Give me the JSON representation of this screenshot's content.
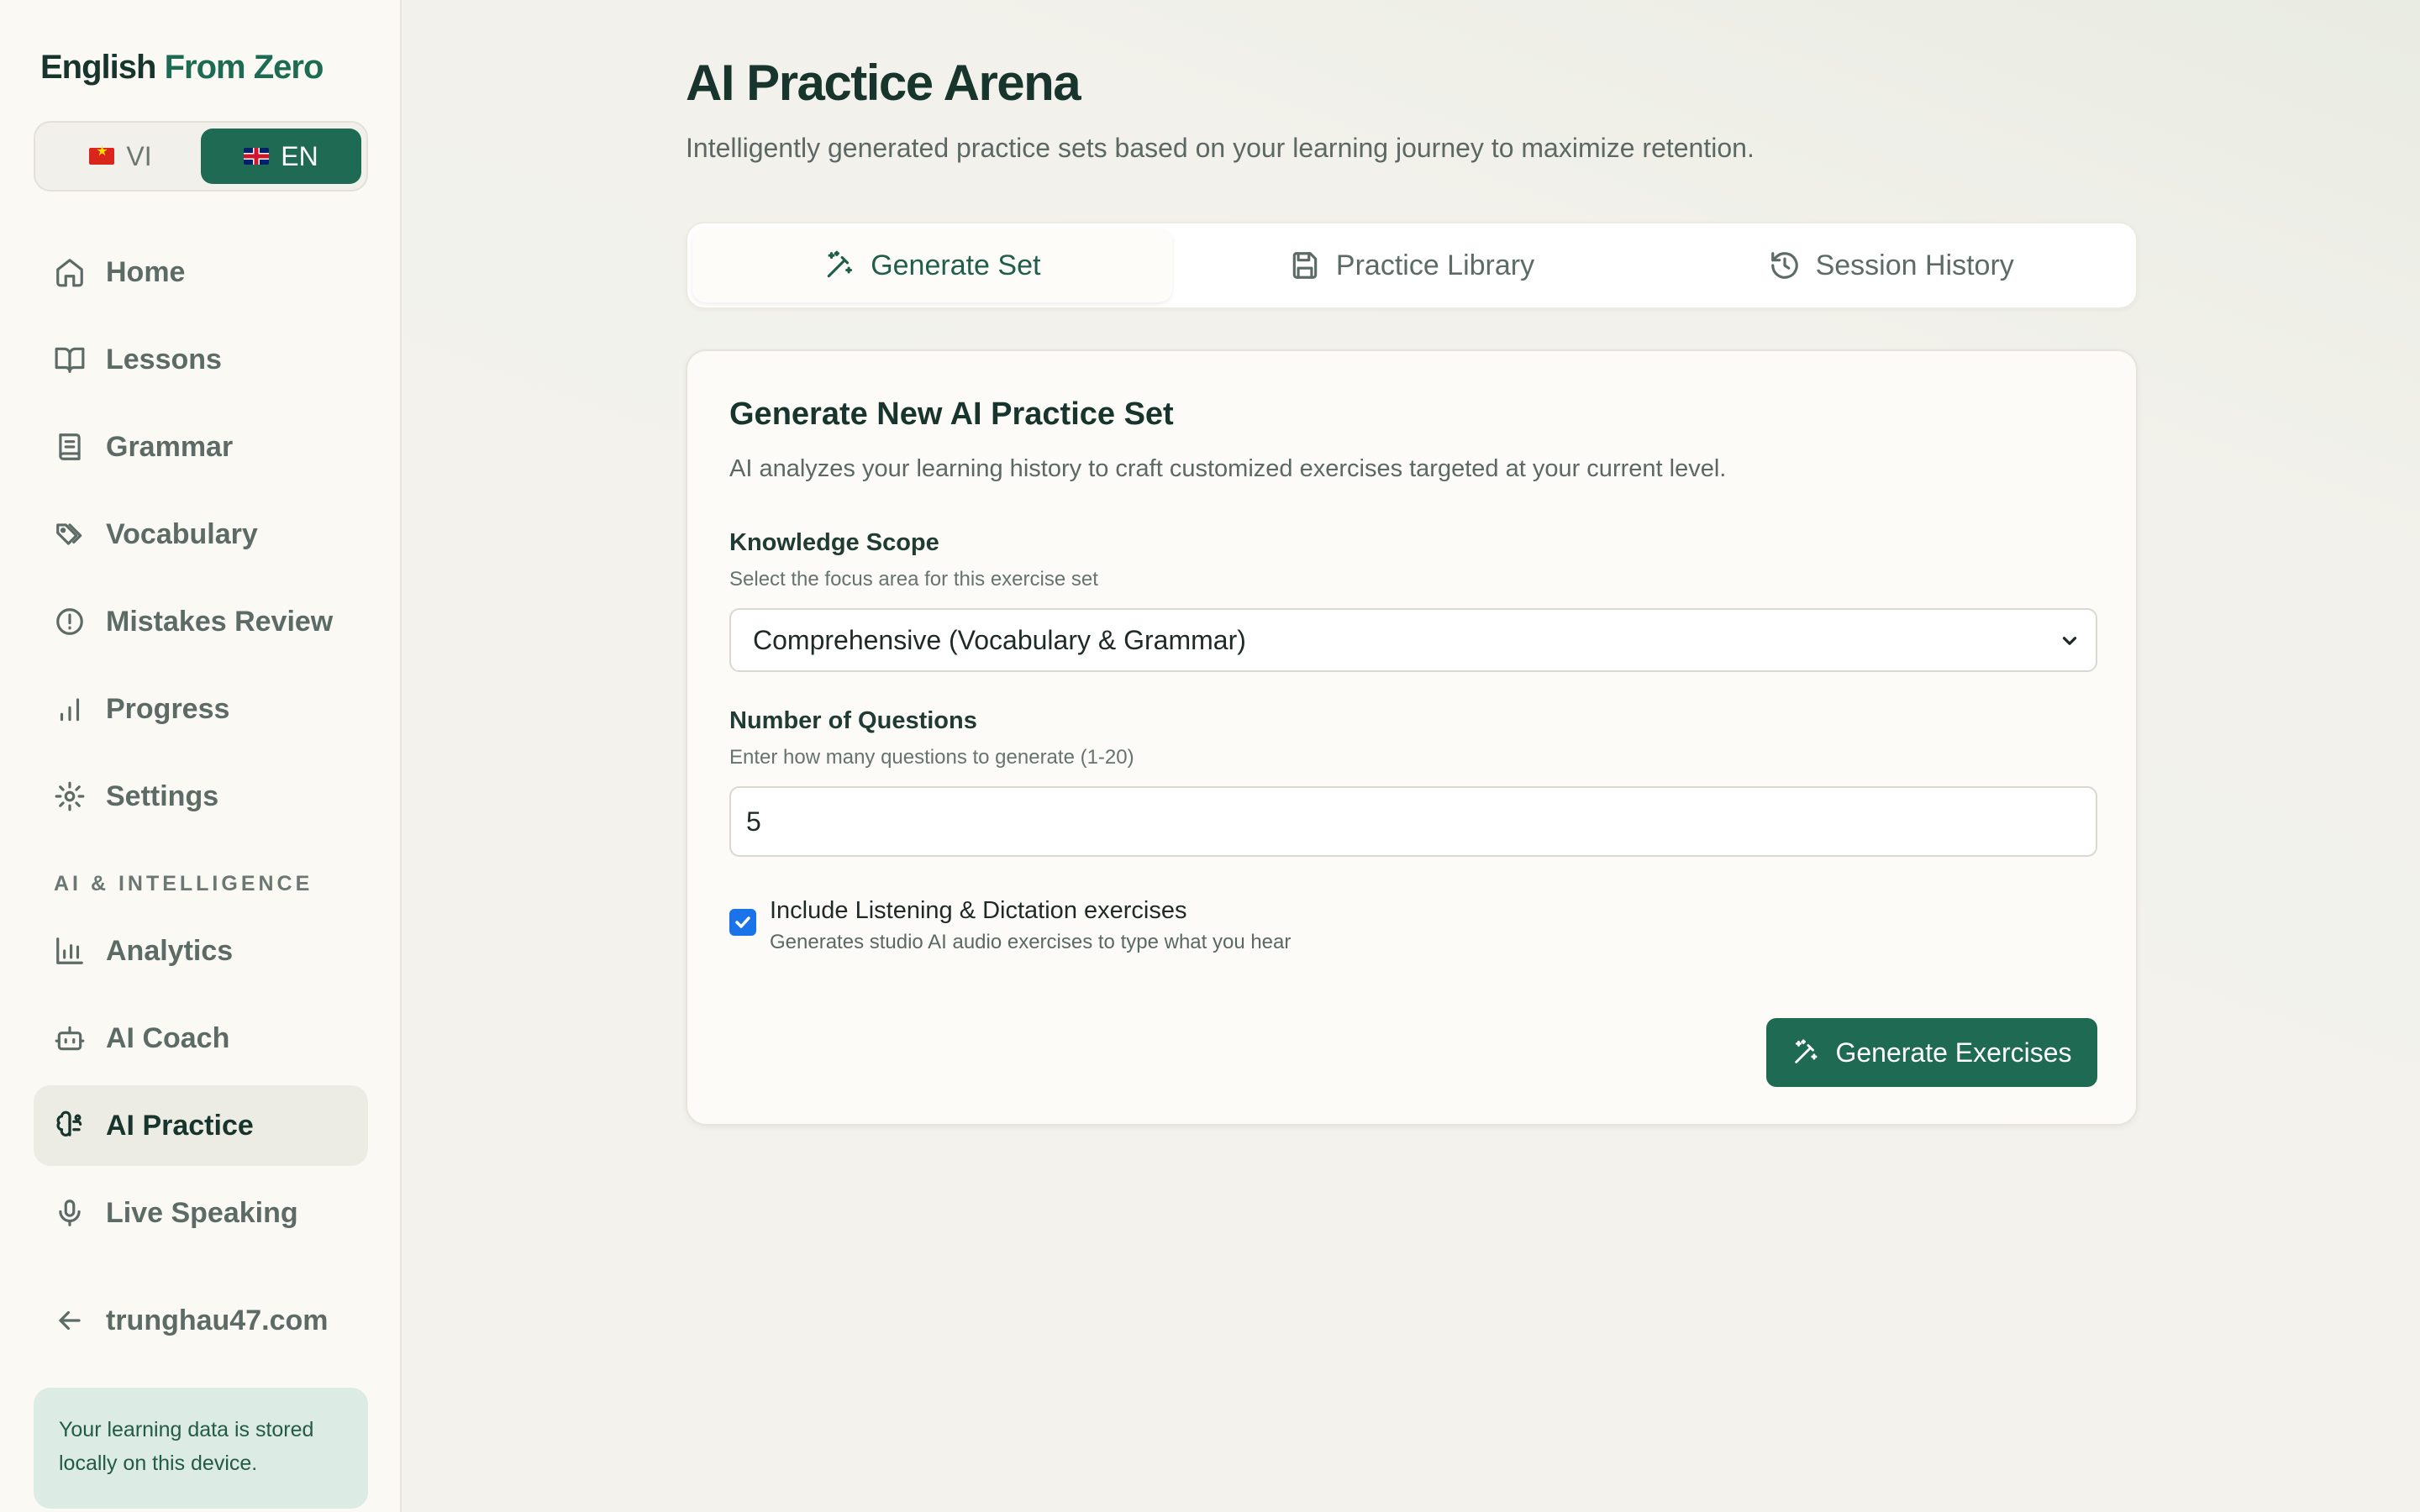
{
  "brand": {
    "part1": "English",
    "part2": "From Zero"
  },
  "language": {
    "vi_label": "VI",
    "en_label": "EN",
    "active": "EN"
  },
  "sidebar": {
    "items": [
      {
        "label": "Home",
        "icon": "home-icon"
      },
      {
        "label": "Lessons",
        "icon": "book-open-icon"
      },
      {
        "label": "Grammar",
        "icon": "book-icon"
      },
      {
        "label": "Vocabulary",
        "icon": "tags-icon"
      },
      {
        "label": "Mistakes Review",
        "icon": "alert-circle-icon"
      },
      {
        "label": "Progress",
        "icon": "bar-chart-icon"
      },
      {
        "label": "Settings",
        "icon": "gear-icon"
      }
    ],
    "section_label": "AI & INTELLIGENCE",
    "ai_items": [
      {
        "label": "Analytics",
        "icon": "analytics-icon"
      },
      {
        "label": "AI Coach",
        "icon": "bot-icon"
      },
      {
        "label": "AI Practice",
        "icon": "brain-icon",
        "active": true
      },
      {
        "label": "Live Speaking",
        "icon": "mic-icon"
      }
    ],
    "back_link": "trunghau47.com",
    "storage_note": "Your learning data is stored locally on this device."
  },
  "page": {
    "title": "AI Practice Arena",
    "subtitle": "Intelligently generated practice sets based on your learning journey to maximize retention."
  },
  "tabs": [
    {
      "label": "Generate Set",
      "icon": "wand-icon",
      "active": true
    },
    {
      "label": "Practice Library",
      "icon": "save-icon"
    },
    {
      "label": "Session History",
      "icon": "history-icon"
    }
  ],
  "form": {
    "title": "Generate New AI Practice Set",
    "description": "AI analyzes your learning history to craft customized exercises targeted at your current level.",
    "scope_label": "Knowledge Scope",
    "scope_hint": "Select the focus area for this exercise set",
    "scope_value": "Comprehensive (Vocabulary & Grammar)",
    "count_label": "Number of Questions",
    "count_hint": "Enter how many questions to generate (1-20)",
    "count_value": "5",
    "listening_label": "Include Listening & Dictation exercises",
    "listening_hint": "Generates studio AI audio exercises to type what you hear",
    "listening_checked": true,
    "submit_label": "Generate Exercises"
  },
  "colors": {
    "accent": "#1f6a53",
    "checkbox": "#1a73e8",
    "note_bg": "#dcebe3"
  }
}
